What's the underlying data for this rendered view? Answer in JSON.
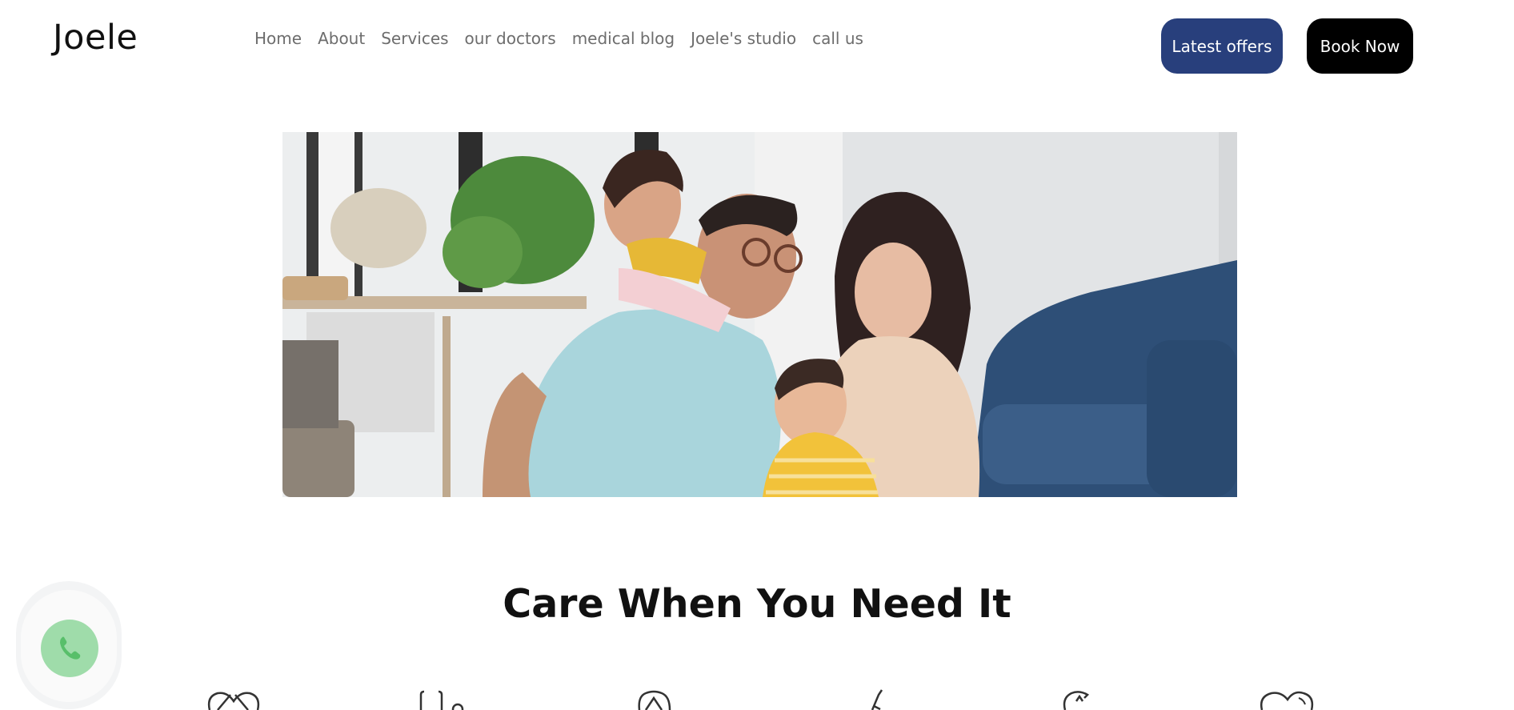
{
  "header": {
    "logo": "Joele",
    "nav": [
      {
        "label": "Home"
      },
      {
        "label": "About"
      },
      {
        "label": "Services"
      },
      {
        "label": "our doctors"
      },
      {
        "label": "medical blog"
      },
      {
        "label": "Joele's studio"
      },
      {
        "label": "call us"
      }
    ],
    "offers_button": "Latest offers",
    "book_button": "Book Now"
  },
  "hero": {
    "image_icon": "family-photo"
  },
  "main": {
    "headline": "Care When You Need It"
  },
  "floating": {
    "whatsapp_icon": "whatsapp-phone-icon"
  },
  "services_icons": [
    "heart-pulse-icon",
    "stethoscope-icon",
    "tooth-icon",
    "syringe-icon",
    "brain-icon",
    "heart-icon"
  ],
  "colors": {
    "offers_bg": "#283f7c",
    "book_bg": "#000000",
    "nav_text": "#6d6d6d",
    "whatsapp": "#9fdcaa"
  }
}
